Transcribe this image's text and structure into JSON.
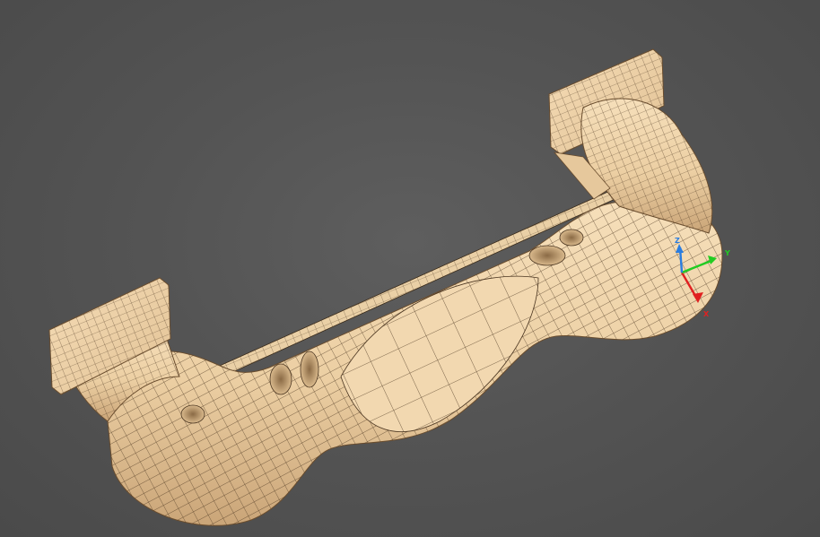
{
  "viewport": {
    "model": "mesh-model",
    "surface_color": "#f0d6ae",
    "wire_color": "#3a2a18",
    "background": "#555555"
  },
  "axis_gizmo": {
    "x_label": "X",
    "y_label": "Y",
    "z_label": "Z",
    "x_color": "#e02020",
    "y_color": "#22cc22",
    "z_color": "#2a7de0"
  }
}
